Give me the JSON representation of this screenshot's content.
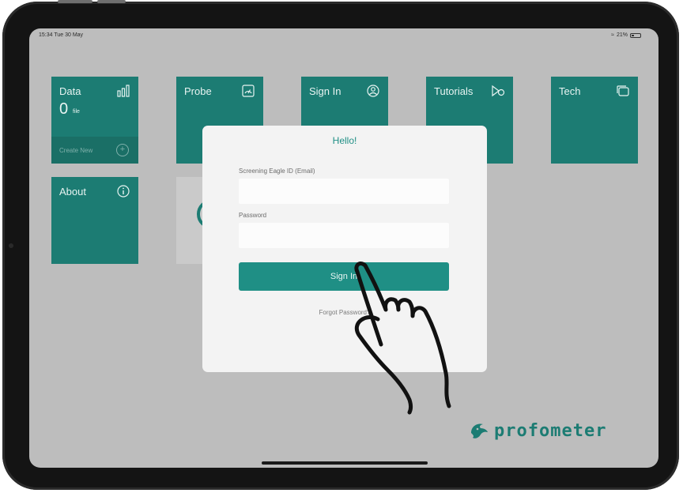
{
  "status_bar": {
    "time_date": "15:34  Tue 30 May",
    "battery": "21%"
  },
  "tiles": {
    "data": {
      "label": "Data",
      "count": "0",
      "unit": "file",
      "create_new": "Create New"
    },
    "probe": {
      "label": "Probe"
    },
    "sign_in": {
      "label": "Sign In"
    },
    "tutorials": {
      "label": "Tutorials"
    },
    "tech": {
      "label": "Tech"
    },
    "about": {
      "label": "About"
    }
  },
  "modal": {
    "title": "Hello!",
    "email_label": "Screening Eagle ID (Email)",
    "email_value": "",
    "password_label": "Password",
    "password_value": "",
    "sign_in_button": "Sign In",
    "forgot_password": "Forgot Password?"
  },
  "brand": {
    "name": "profometer",
    "color": "#1c7c73"
  },
  "colors": {
    "accent": "#1f8f85",
    "tile": "#1c7c73",
    "overlay_bg": "#bdbdbd"
  }
}
